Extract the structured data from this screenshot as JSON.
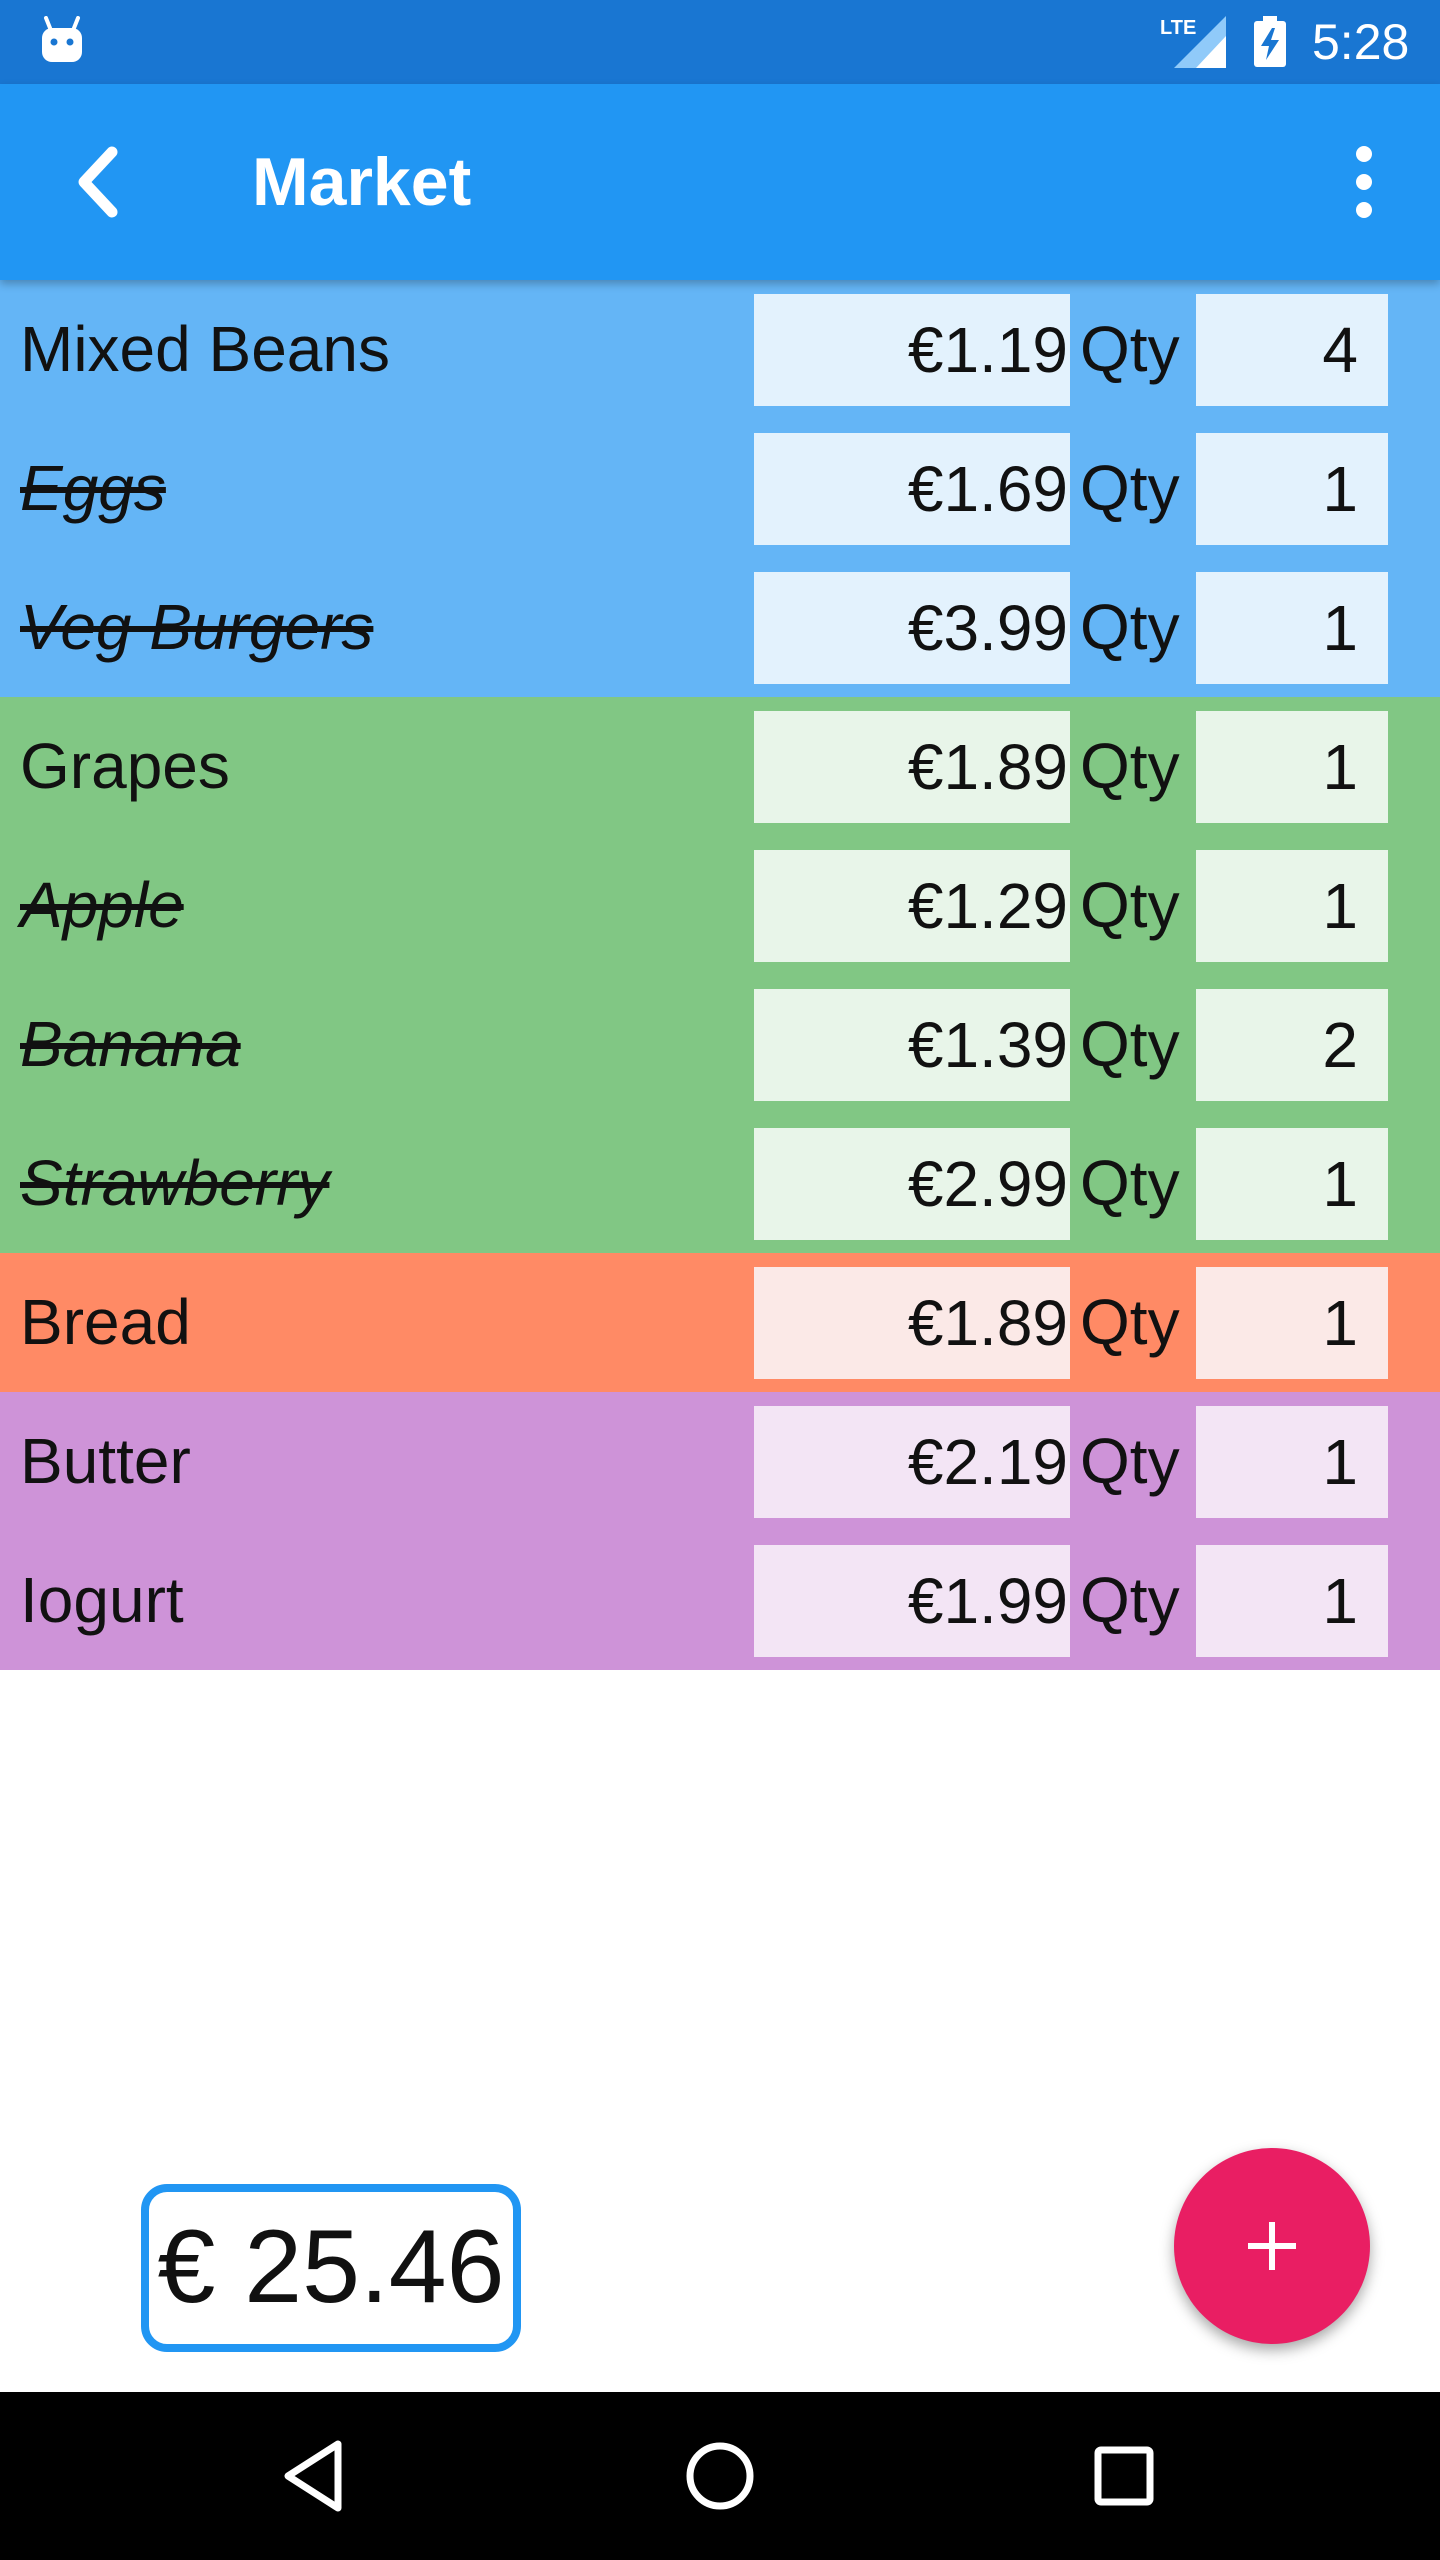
{
  "status_bar": {
    "time": "5:28",
    "network_label": "LTE",
    "icons": [
      "android-debug-icon",
      "lte-signal-icon",
      "battery-charging-icon"
    ]
  },
  "app_bar": {
    "title": "Market",
    "back_icon": "chevron-left-icon",
    "menu_icon": "more-vert-icon",
    "background": "#2196f3"
  },
  "qty_label": "Qty",
  "groups": [
    {
      "row_color": "#64b5f6",
      "field_color": "#e3f2fd",
      "items": [
        {
          "name": "Mixed Beans",
          "price": "€1.19",
          "qty": "4",
          "checked": false
        },
        {
          "name": "Eggs",
          "price": "€1.69",
          "qty": "1",
          "checked": true
        },
        {
          "name": "Veg Burgers",
          "price": "€3.99",
          "qty": "1",
          "checked": true
        }
      ]
    },
    {
      "row_color": "#81c784",
      "field_color": "#e8f5e9",
      "items": [
        {
          "name": "Grapes",
          "price": "€1.89",
          "qty": "1",
          "checked": false
        },
        {
          "name": "Apple",
          "price": "€1.29",
          "qty": "1",
          "checked": true
        },
        {
          "name": "Banana",
          "price": "€1.39",
          "qty": "2",
          "checked": true
        },
        {
          "name": "Strawberry",
          "price": "€2.99",
          "qty": "1",
          "checked": true
        }
      ]
    },
    {
      "row_color": "#ff8a65",
      "field_color": "#fbe9e7",
      "items": [
        {
          "name": "Bread",
          "price": "€1.89",
          "qty": "1",
          "checked": false
        }
      ]
    },
    {
      "row_color": "#ce93d8",
      "field_color": "#f3e5f5",
      "items": [
        {
          "name": "Butter",
          "price": "€2.19",
          "qty": "1",
          "checked": false
        },
        {
          "name": "Iogurt",
          "price": "€1.99",
          "qty": "1",
          "checked": false
        }
      ]
    }
  ],
  "total": {
    "text": "€ 25.46",
    "border_color": "#2196f3"
  },
  "fab": {
    "icon": "plus-icon",
    "color": "#e91e63"
  },
  "nav_bar": {
    "icons": [
      "back-triangle-icon",
      "home-circle-icon",
      "recents-square-icon"
    ]
  }
}
